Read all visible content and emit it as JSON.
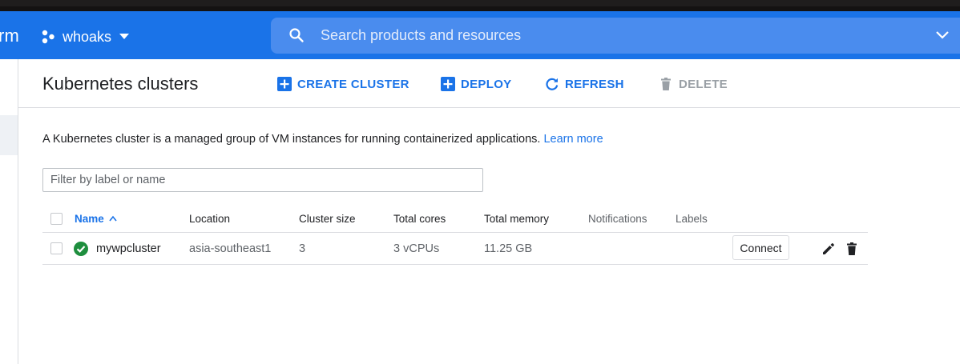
{
  "appbar": {
    "brand_fragment": "rm",
    "project_name": "whoaks",
    "search_placeholder": "Search products and resources"
  },
  "header": {
    "title": "Kubernetes clusters",
    "buttons": {
      "create": "CREATE CLUSTER",
      "deploy": "DEPLOY",
      "refresh": "REFRESH",
      "delete": "DELETE"
    }
  },
  "main": {
    "description": "A Kubernetes cluster is a managed group of VM instances for running containerized applications.",
    "learn_more": "Learn more",
    "filter_placeholder": "Filter by label or name"
  },
  "table": {
    "columns": {
      "name": "Name",
      "location": "Location",
      "cluster_size": "Cluster size",
      "total_cores": "Total cores",
      "total_memory": "Total memory",
      "notifications": "Notifications",
      "labels": "Labels"
    },
    "rows": [
      {
        "name": "mywpcluster",
        "location": "asia-southeast1",
        "cluster_size": "3",
        "total_cores": "3 vCPUs",
        "total_memory": "11.25 GB",
        "connect": "Connect"
      }
    ]
  },
  "colors": {
    "brand_blue": "#1a73e8",
    "status_ok": "#1e8e3e",
    "disabled": "#9aa0a6"
  },
  "icons": [
    "hexagon-project-icon",
    "search-icon",
    "chevron-down-icon",
    "add-box-icon",
    "refresh-icon",
    "trash-icon",
    "check-circle-icon",
    "pencil-icon"
  ]
}
